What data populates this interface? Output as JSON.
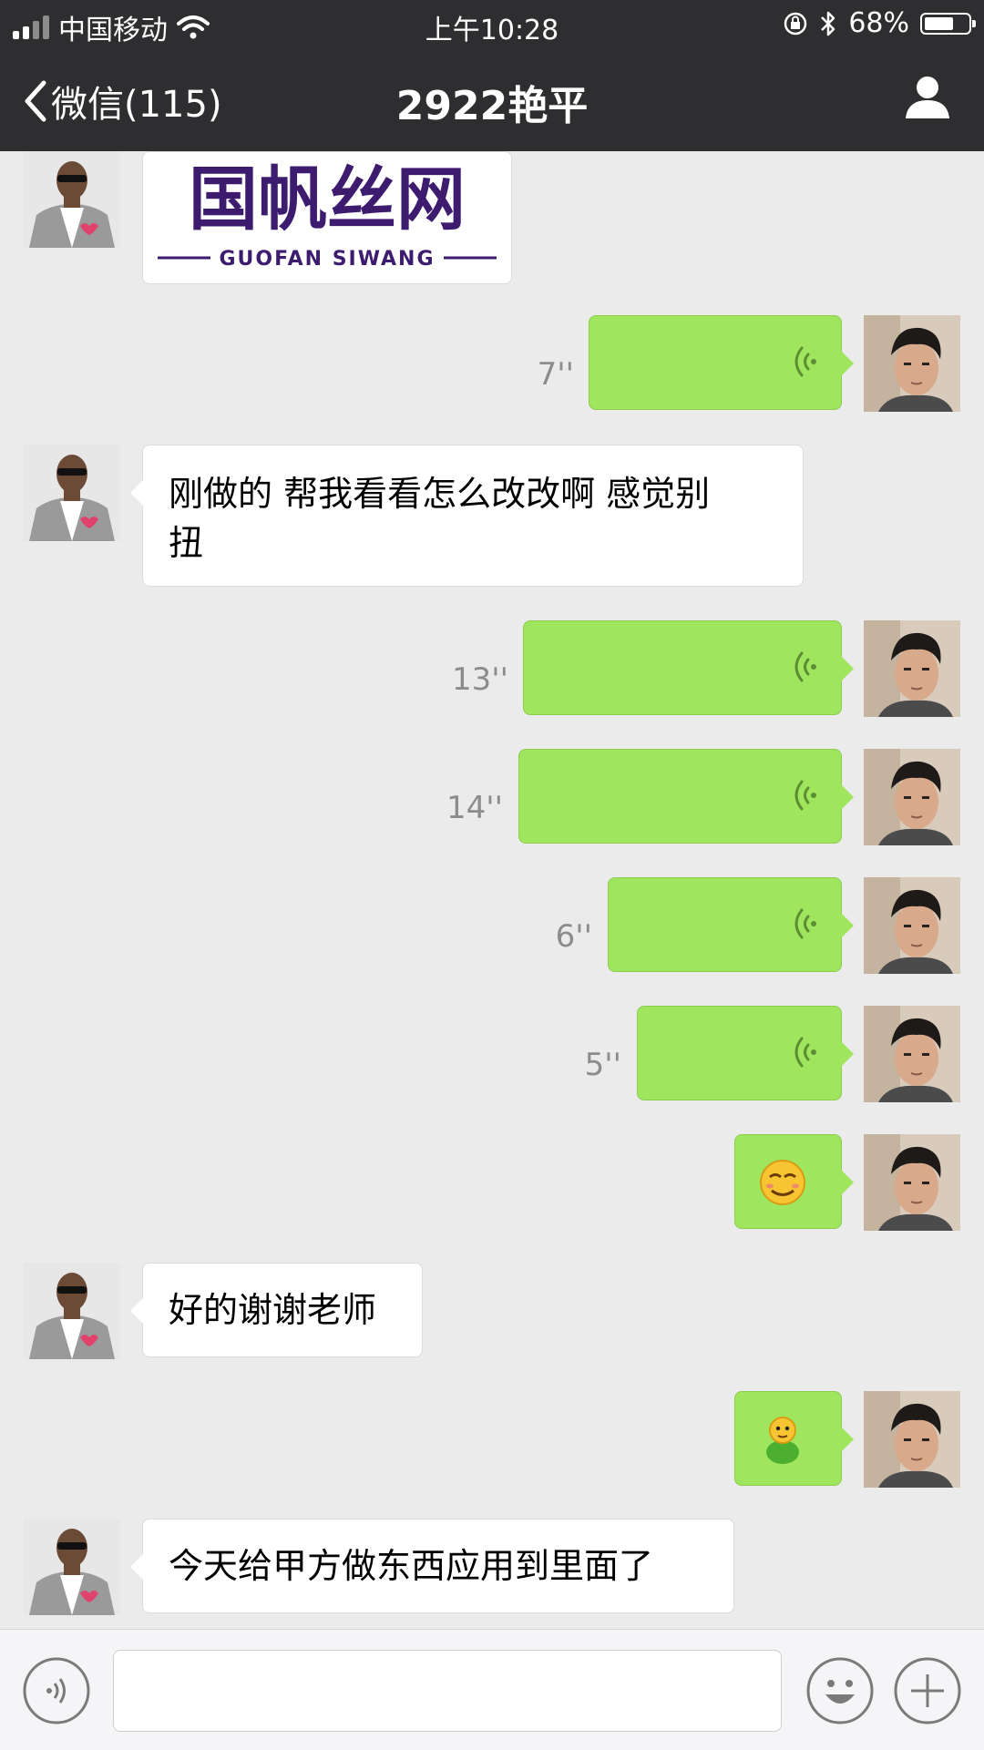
{
  "status_bar": {
    "carrier": "中国移动",
    "time": "上午10:28",
    "battery": "68%",
    "battery_level": 0.68
  },
  "nav": {
    "back_label": "微信(115)",
    "title": "2922艳平",
    "profile_icon": "person-icon"
  },
  "logo": {
    "main": "国帆丝网",
    "sub": "GUOFAN SIWANG",
    "color": "#3d1b6e"
  },
  "messages": [
    {
      "side": "left",
      "type": "image"
    },
    {
      "side": "right",
      "type": "voice",
      "duration": "7''"
    },
    {
      "side": "left",
      "type": "text",
      "lines": [
        "刚做的 帮我看看怎么改改啊  感觉别",
        "扭"
      ]
    },
    {
      "side": "right",
      "type": "voice",
      "duration": "13''"
    },
    {
      "side": "right",
      "type": "voice",
      "duration": "14''"
    },
    {
      "side": "right",
      "type": "voice",
      "duration": "6''"
    },
    {
      "side": "right",
      "type": "voice",
      "duration": "5''"
    },
    {
      "side": "right",
      "type": "emoji",
      "emoji": "smirk-emoji"
    },
    {
      "side": "left",
      "type": "text",
      "text": "好的谢谢老师"
    },
    {
      "side": "right",
      "type": "emoji",
      "emoji": "green-figure-emoji"
    },
    {
      "side": "left",
      "type": "text",
      "text": "今天给甲方做东西应用到里面了"
    }
  ],
  "colors": {
    "bar": "#2e2e30",
    "chat_bg": "#ebebeb",
    "green_bubble": "#9fe65e"
  },
  "input_bar": {
    "voice_button": "voice-mode-icon",
    "emoji_button": "emoji-icon",
    "more_button": "plus-icon"
  }
}
